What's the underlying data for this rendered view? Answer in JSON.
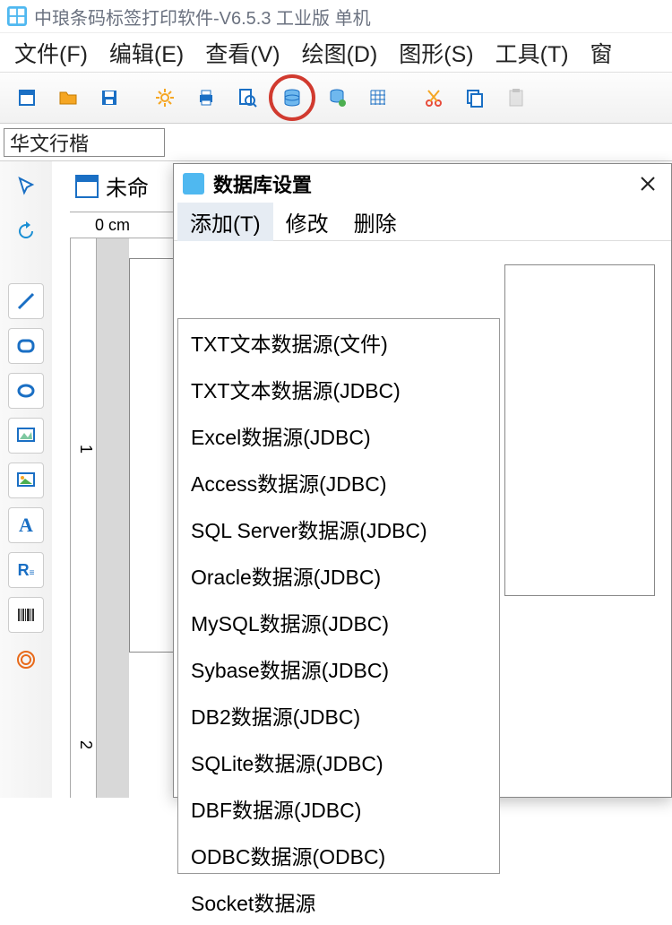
{
  "app": {
    "title": "中琅条码标签打印软件-V6.5.3 工业版 单机"
  },
  "menubar": [
    {
      "label": "文件(F)"
    },
    {
      "label": "编辑(E)"
    },
    {
      "label": "查看(V)"
    },
    {
      "label": "绘图(D)"
    },
    {
      "label": "图形(S)"
    },
    {
      "label": "工具(T)"
    },
    {
      "label": "窗"
    }
  ],
  "toolbar": {
    "new": "new-icon",
    "open": "open-icon",
    "save": "save-icon",
    "settings": "gear-icon",
    "print": "print-icon",
    "preview": "preview-icon",
    "database": "database-icon",
    "db_connect": "db-connect-icon",
    "grid": "grid-icon",
    "cut": "cut-icon",
    "copy": "copy-icon",
    "paste": "paste-icon"
  },
  "fontbar": {
    "font_name": "华文行楷"
  },
  "left_tools": [
    "pointer-icon",
    "refresh-icon",
    "line-icon",
    "rounded-rect-icon",
    "ellipse-icon",
    "image-frame-icon",
    "image-color-icon",
    "text-A-icon",
    "text-R-icon",
    "barcode-icon",
    "qrcode-icon"
  ],
  "document": {
    "tab_label": "未命",
    "ruler_h_label": "0 cm",
    "ruler_v_ticks": [
      "1",
      "2"
    ]
  },
  "dialog": {
    "title": "数据库设置",
    "menu": {
      "add": "添加(T)",
      "edit": "修改",
      "delete": "删除"
    },
    "add_options": [
      "TXT文本数据源(文件)",
      "TXT文本数据源(JDBC)",
      "Excel数据源(JDBC)",
      "Access数据源(JDBC)",
      "SQL Server数据源(JDBC)",
      "Oracle数据源(JDBC)",
      "MySQL数据源(JDBC)",
      "Sybase数据源(JDBC)",
      "DB2数据源(JDBC)",
      "SQLite数据源(JDBC)",
      "DBF数据源(JDBC)",
      "ODBC数据源(ODBC)",
      "Socket数据源"
    ]
  },
  "colors": {
    "highlight_ring": "#d13a2f",
    "icon_blue": "#1a6fc4",
    "icon_orange": "#f5a623"
  }
}
